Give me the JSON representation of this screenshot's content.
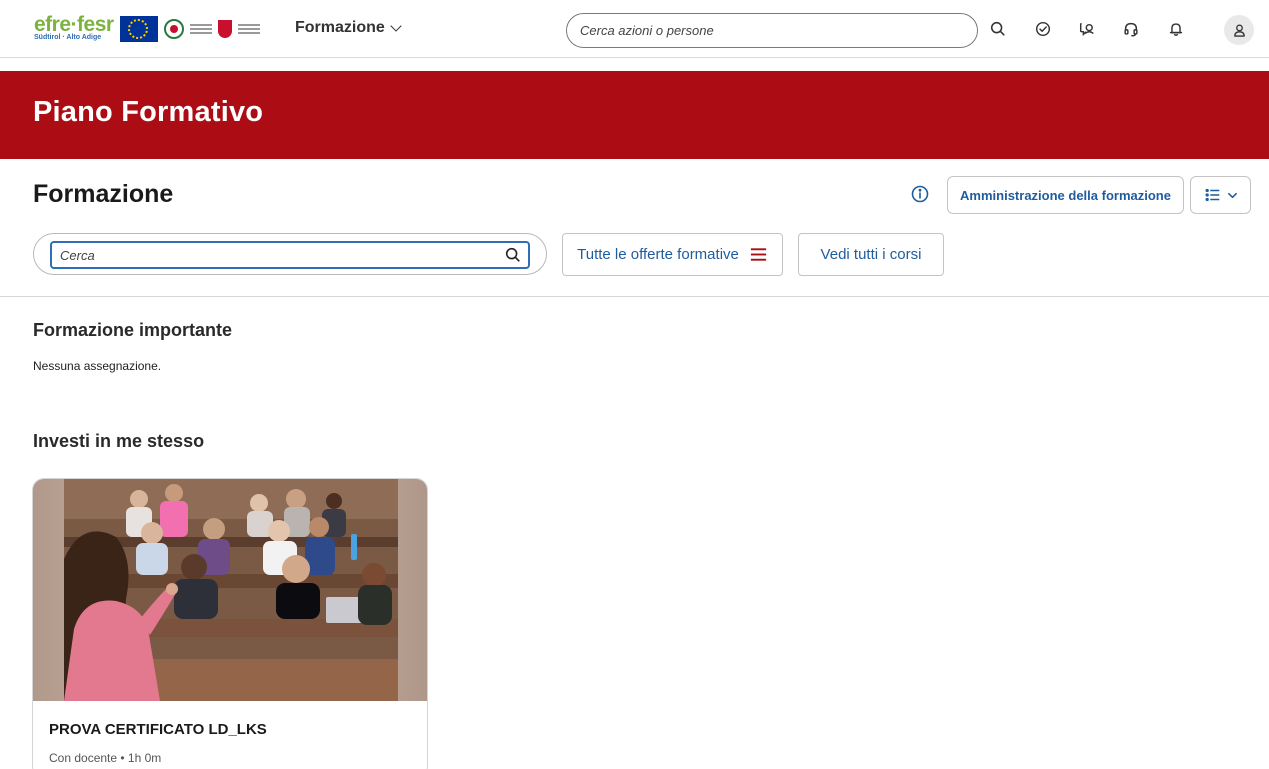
{
  "header": {
    "logo": {
      "efre_text": "efre·fesr",
      "region_text": "Südtirol · Alto Adige"
    },
    "nav_menu_label": "Formazione",
    "search_placeholder": "Cerca azioni o persone",
    "icons": [
      "search-icon",
      "check-circle-icon",
      "chat-icon",
      "headset-icon",
      "bell-icon",
      "user-icon"
    ]
  },
  "banner": {
    "title": "Piano Formativo"
  },
  "main": {
    "section_title": "Formazione",
    "admin_button_label": "Amministrazione della formazione",
    "search_placeholder": "Cerca",
    "filter_button_label": "Tutte le offerte formative",
    "all_courses_button_label": "Vedi tutti i corsi",
    "important": {
      "title": "Formazione importante",
      "empty_text": "Nessuna assegnazione."
    },
    "invest": {
      "title": "Investi in me stesso",
      "cards": [
        {
          "title": "PROVA CERTIFICATO LD_LKS",
          "meta": "Con docente • 1h 0m"
        }
      ]
    }
  },
  "colors": {
    "brand_red": "#ac0d14",
    "link_blue": "#1f5c9e",
    "focus_blue": "#2f6db5"
  }
}
